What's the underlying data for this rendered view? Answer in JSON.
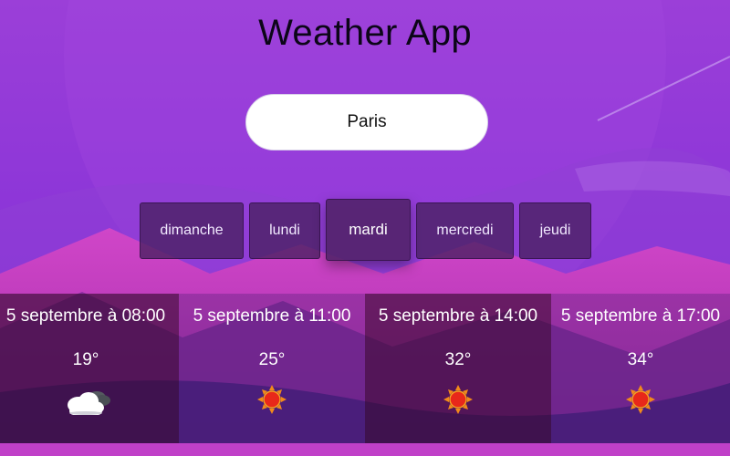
{
  "header": {
    "title": "Weather App"
  },
  "search": {
    "value": "Paris"
  },
  "days": [
    {
      "label": "dimanche",
      "active": false
    },
    {
      "label": "lundi",
      "active": false
    },
    {
      "label": "mardi",
      "active": true
    },
    {
      "label": "mercredi",
      "active": false
    },
    {
      "label": "jeudi",
      "active": false
    }
  ],
  "forecast": [
    {
      "time": "5 septembre à 08:00",
      "temp": "19°",
      "icon": "partly-cloudy-icon"
    },
    {
      "time": "5 septembre à 11:00",
      "temp": "25°",
      "icon": "sun-icon"
    },
    {
      "time": "5 septembre à 14:00",
      "temp": "32°",
      "icon": "sun-icon"
    },
    {
      "time": "5 septembre à 17:00",
      "temp": "34°",
      "icon": "sun-icon"
    }
  ],
  "colors": {
    "accent_bg": "#8a33d6",
    "tab_bg": "#482060",
    "sun": "#e8281a"
  }
}
